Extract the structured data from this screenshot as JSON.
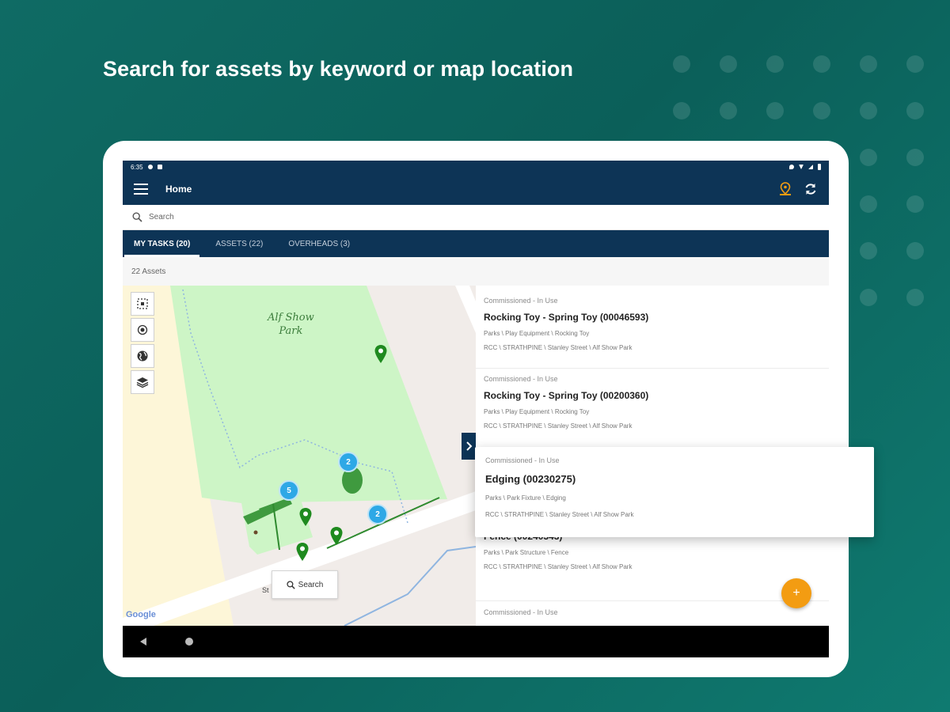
{
  "headline": "Search for assets by keyword or map location",
  "status_bar": {
    "time": "6:35"
  },
  "app_bar": {
    "title": "Home",
    "accent": "#f39c12"
  },
  "search": {
    "placeholder": "Search"
  },
  "tabs": [
    {
      "label": "MY TASKS (20)",
      "active": true
    },
    {
      "label": "ASSETS (22)",
      "active": false
    },
    {
      "label": "OVERHEADS (3)",
      "active": false
    }
  ],
  "asset_count": "22 Assets",
  "map": {
    "park_label_line1": "Alf Show",
    "park_label_line2": "Park",
    "street_label": "St",
    "cluster_counts": [
      "2",
      "5",
      "2"
    ],
    "search_button": "Search",
    "attribution": "Google"
  },
  "assets": [
    {
      "status": "Commissioned - In Use",
      "name": "Rocking Toy - Spring Toy (00046593)",
      "category": "Parks \\ Play Equipment \\ Rocking Toy",
      "location": "RCC \\ STRATHPINE \\ Stanley Street \\ Alf Show Park"
    },
    {
      "status": "Commissioned - In Use",
      "name": "Rocking Toy - Spring Toy (00200360)",
      "category": "Parks \\ Play Equipment \\ Rocking Toy",
      "location": "RCC \\ STRATHPINE \\ Stanley Street \\ Alf Show Park"
    },
    {
      "status": "Commissioned - In Use",
      "name": "Fence (00240343)",
      "category": "Parks \\ Park Structure \\ Fence",
      "location": "RCC \\ STRATHPINE \\ Stanley Street \\ Alf Show Park"
    },
    {
      "status": "Commissioned - In Use",
      "name": "",
      "category": "",
      "location": ""
    }
  ],
  "highlighted_asset": {
    "status": "Commissioned - In Use",
    "name": "Edging (00230275)",
    "category": "Parks \\ Park Fixture \\ Edging",
    "location": "RCC \\ STRATHPINE \\ Stanley Street \\ Alf Show Park"
  },
  "fab": {
    "label": "+"
  }
}
